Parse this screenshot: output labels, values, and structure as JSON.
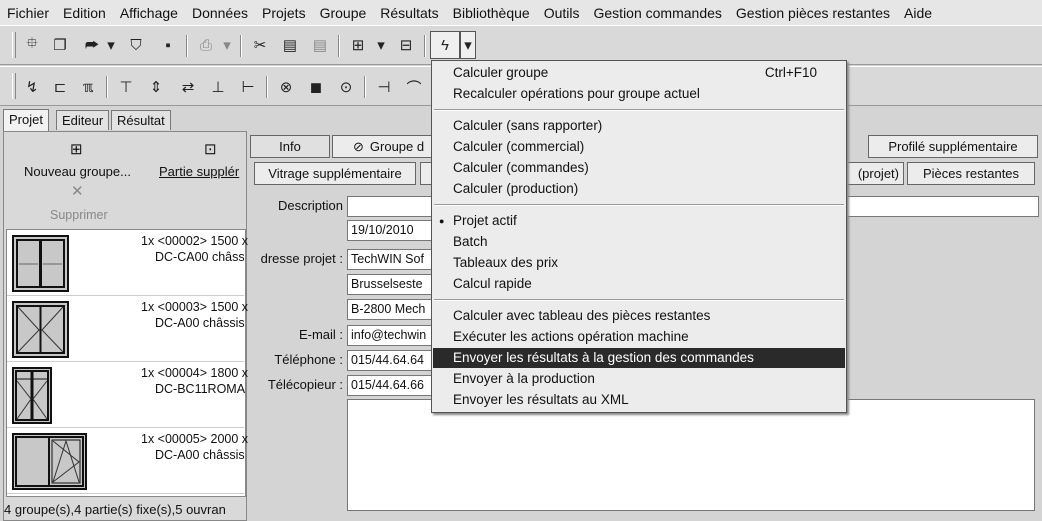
{
  "menubar": [
    "Fichier",
    "Edition",
    "Affichage",
    "Données",
    "Projets",
    "Groupe",
    "Résultats",
    "Bibliothèque",
    "Outils",
    "Gestion commandes",
    "Gestion pièces restantes",
    "Aide"
  ],
  "icons": {
    "new": "⯐",
    "copy": "❐",
    "open": "⮫",
    "arrow": "▾",
    "stamp": "⛉",
    "save": "▪",
    "print": "⎙",
    "cut": "✂",
    "paste": "📋",
    "paste2": "▤",
    "grid": "⊞",
    "grid2": "⊟",
    "lightning": "ϟ",
    "t1": "↯",
    "t2": "⊏",
    "t3": "ℼ",
    "t4": "⊤",
    "t5": "⇕",
    "t6": "⇄",
    "t7": "⊥",
    "t8": "⊢",
    "t9": "⊗",
    "t10": "◼",
    "t11": "⊙",
    "t12": "⊣",
    "t13": "⌒",
    "x": "✕",
    "new_group": "⊞",
    "partial": "⊡",
    "clip": "⊘",
    "bullet": "●"
  },
  "tabs": [
    "Projet",
    "Editeur",
    "Résultat"
  ],
  "leftpanel": {
    "new_group": "Nouveau groupe...",
    "partial": "Partie supplér",
    "delete": "Supprimer",
    "items": [
      {
        "line1": "1x <00002> 1500 x",
        "line2": "DC-CA00 châss"
      },
      {
        "line1": "1x <00003> 1500 x",
        "line2": "DC-A00 châssis"
      },
      {
        "line1": "1x <00004> 1800 x",
        "line2": "DC-BC11ROMA"
      },
      {
        "line1": "1x <00005> 2000 x",
        "line2": "DC-A00 châssis"
      }
    ],
    "status": "4 groupe(s),4 partie(s) fixe(s),5 ouvran"
  },
  "right": {
    "btn_info": "Info",
    "btn_groupe": "Groupe d",
    "btn_profile": "Profilé supplémentaire",
    "btn_vitrage": "Vitrage supplémentaire",
    "btn_projet": "(projet)",
    "btn_pieces": "Pièces restantes",
    "labels": {
      "description": "Description",
      "adresse": "dresse projet :",
      "email": "E-mail :",
      "telephone": "Téléphone :",
      "telecopieur": "Télécopieur :"
    },
    "fields": {
      "date": "19/10/2010",
      "company": "TechWIN Sof",
      "street": "Brusselseste",
      "city": "B-2800 Mech",
      "email": "info@techwin",
      "phone": "015/44.64.64",
      "fax": "015/44.64.66"
    }
  },
  "menu": {
    "items": [
      {
        "label": "Calculer groupe",
        "shortcut": "Ctrl+F10"
      },
      {
        "label": "Recalculer opérations pour groupe actuel"
      },
      {
        "sep": true
      },
      {
        "label": "Calculer (sans rapporter)"
      },
      {
        "label": "Calculer (commercial)"
      },
      {
        "label": "Calculer (commandes)"
      },
      {
        "label": "Calculer (production)"
      },
      {
        "sep": true
      },
      {
        "label": "Projet actif",
        "checked": true
      },
      {
        "label": "Batch"
      },
      {
        "label": "Tableaux des prix"
      },
      {
        "label": "Calcul rapide"
      },
      {
        "sep": true
      },
      {
        "label": "Calculer avec tableau des pièces restantes"
      },
      {
        "label": "Exécuter les actions opération machine"
      },
      {
        "label": "Envoyer les résultats à la gestion des commandes",
        "highlighted": true
      },
      {
        "label": "Envoyer à la production"
      },
      {
        "label": "Envoyer les résultats au XML"
      }
    ]
  }
}
